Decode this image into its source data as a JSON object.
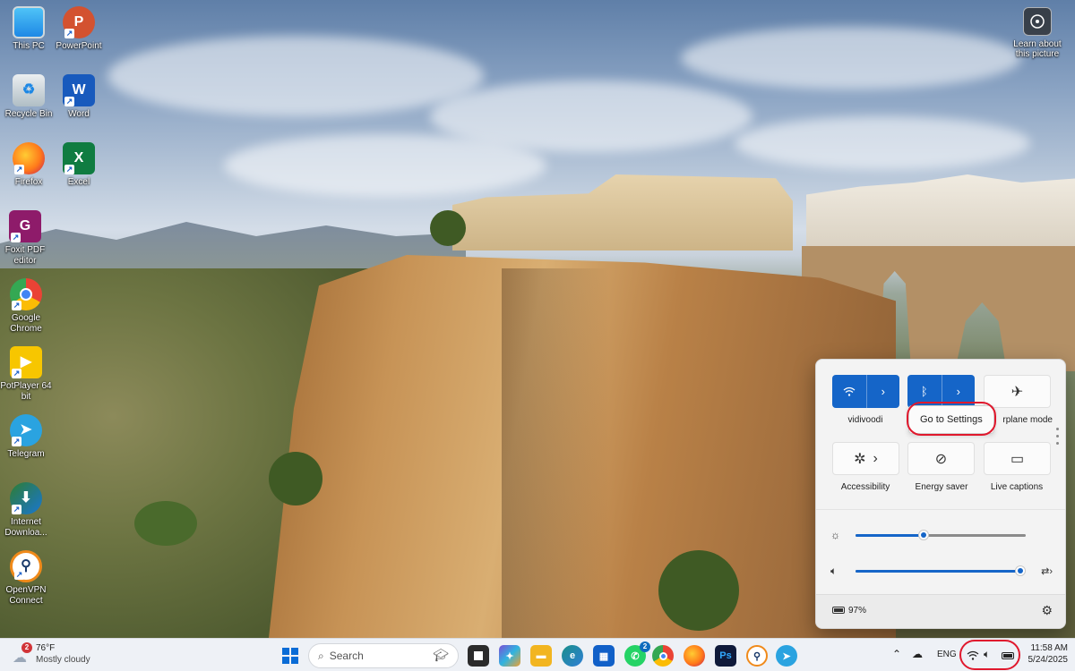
{
  "desktop": {
    "icons": [
      {
        "label": "This PC",
        "icon": "computer-icon"
      },
      {
        "label": "PowerPoint",
        "icon": "powerpoint-icon"
      },
      {
        "label": "Recycle Bin",
        "icon": "recycle-bin-icon"
      },
      {
        "label": "Word",
        "icon": "word-icon"
      },
      {
        "label": "Firefox",
        "icon": "firefox-icon"
      },
      {
        "label": "Excel",
        "icon": "excel-icon"
      },
      {
        "label": "Foxit PDF editor",
        "icon": "foxit-pdf-icon"
      },
      {
        "label": "Google Chrome",
        "icon": "chrome-icon"
      },
      {
        "label": "PotPlayer 64 bit",
        "icon": "potplayer-icon"
      },
      {
        "label": "Telegram",
        "icon": "telegram-icon"
      },
      {
        "label": "Internet Downloa...",
        "icon": "internet-download-manager-icon"
      },
      {
        "label": "OpenVPN Connect",
        "icon": "openvpn-icon"
      }
    ],
    "learn_about_picture": "Learn about this picture"
  },
  "quick_settings": {
    "tiles": [
      {
        "label": "vidivoodi",
        "icon": "wifi-icon",
        "state": "on",
        "has_chevron": true
      },
      {
        "label": "Bluetooth",
        "icon": "bluetooth-icon",
        "state": "on",
        "has_chevron": true
      },
      {
        "label": "Airplane mode",
        "icon": "airplane-icon",
        "state": "off",
        "has_chevron": false
      },
      {
        "label": "Accessibility",
        "icon": "accessibility-icon",
        "state": "off",
        "has_chevron": true
      },
      {
        "label": "Energy saver",
        "icon": "energy-saver-icon",
        "state": "off",
        "has_chevron": false
      },
      {
        "label": "Live captions",
        "icon": "live-captions-icon",
        "state": "off",
        "has_chevron": false
      }
    ],
    "tooltip": "Go to Settings",
    "visible_airplane_label": "rplane mode",
    "brightness": {
      "icon": "brightness-icon",
      "level": 0.4
    },
    "volume": {
      "icon": "speaker-icon",
      "level": 1.0,
      "output_icon": "audio-output-icon"
    },
    "battery": {
      "icon": "battery-icon",
      "percent": "97%"
    },
    "settings_icon": "gear-icon"
  },
  "taskbar": {
    "weather": {
      "temp": "76°F",
      "condition": "Mostly cloudy",
      "badge": "2"
    },
    "search_placeholder": "Search",
    "apps": [
      {
        "name": "start-button",
        "color": "#0a6cd6"
      },
      {
        "name": "task-view",
        "color": "#333333"
      },
      {
        "name": "copilot",
        "color": "#7b4fd6"
      },
      {
        "name": "file-explorer",
        "color": "#f2b520"
      },
      {
        "name": "edge",
        "color": "#1a8f8a"
      },
      {
        "name": "microsoft-store",
        "color": "#1160c8"
      },
      {
        "name": "whatsapp",
        "color": "#25d366",
        "badge": "2"
      },
      {
        "name": "chrome",
        "color": "#de3e30"
      },
      {
        "name": "firefox",
        "color": "#ff7a1a"
      },
      {
        "name": "photoshop",
        "color": "#0f1a3a",
        "text": "Ps"
      },
      {
        "name": "openvpn",
        "color": "#f08a1a"
      },
      {
        "name": "telegram",
        "color": "#2aa3e0"
      }
    ],
    "tray": {
      "language": "ENG",
      "time": "11:58 AM",
      "date": "5/24/2025"
    }
  }
}
